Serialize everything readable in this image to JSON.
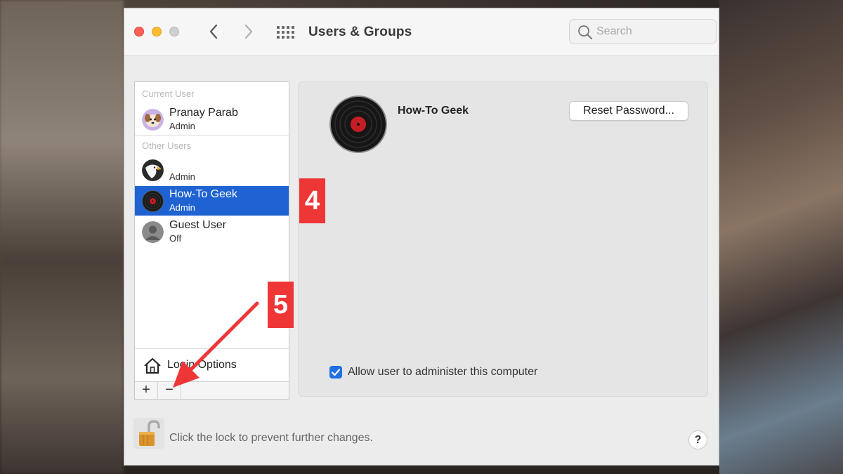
{
  "window": {
    "title": "Users & Groups"
  },
  "toolbar": {
    "back_icon": "chevron-left-icon",
    "forward_icon": "chevron-right-icon",
    "grid_icon": "grid-icon",
    "search_placeholder": "Search"
  },
  "sidebar": {
    "current_user_label": "Current User",
    "other_users_label": "Other Users",
    "users": [
      {
        "name": "Pranay Parab",
        "role": "Admin",
        "selected": false
      },
      {
        "name": "",
        "role": "Admin",
        "selected": false
      },
      {
        "name": "How-To Geek",
        "role": "Admin",
        "selected": true
      },
      {
        "name": "Guest User",
        "role": "Off",
        "selected": false
      }
    ],
    "login_options_label": "Login Options",
    "add_label": "+",
    "remove_label": "−"
  },
  "detail": {
    "user_name": "How-To Geek",
    "reset_password_label": "Reset Password...",
    "admin_checkbox_label": "Allow user to administer this computer",
    "admin_checked": true
  },
  "footer": {
    "lock_text": "Click the lock to prevent further changes.",
    "help_label": "?"
  },
  "annotations": {
    "step_4": "4",
    "step_5": "5",
    "accent_color": "#ee3636"
  },
  "colors": {
    "selection": "#1f63d2",
    "checkbox": "#1f6fe5"
  }
}
